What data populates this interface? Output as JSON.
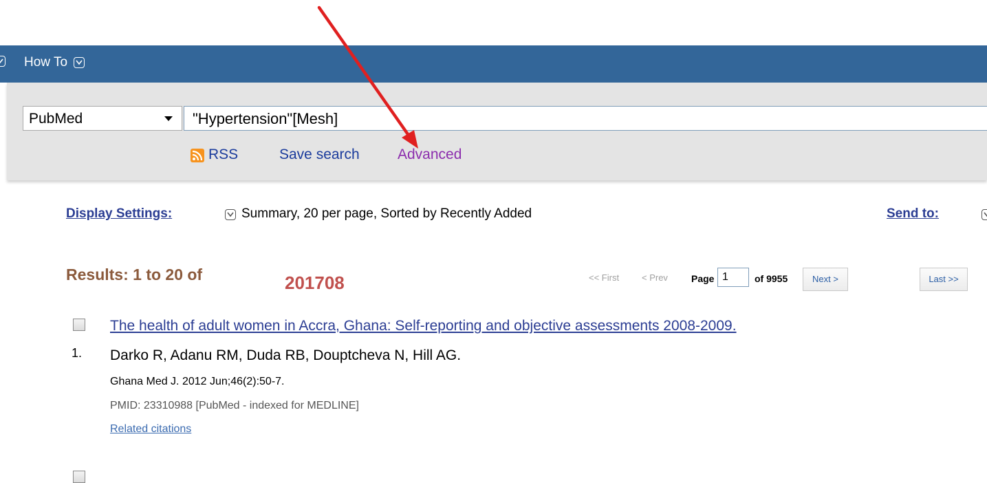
{
  "nav": {
    "howto_label": "How To"
  },
  "search": {
    "database": "PubMed",
    "query": "\"Hypertension\"[Mesh]",
    "rss_label": "RSS",
    "save_search_label": "Save search",
    "advanced_label": "Advanced"
  },
  "display": {
    "settings_label": "Display Settings:",
    "settings_value": "Summary, 20 per page, Sorted by Recently Added",
    "send_to_label": "Send to:"
  },
  "results": {
    "title": "Results: 1 to 20 of",
    "count_annotation": "201708"
  },
  "pager": {
    "first": "<< First",
    "prev": "< Prev",
    "page_label": "Page",
    "page_value": "1",
    "of_label": "of 9955",
    "next": "Next >",
    "last": "Last >>"
  },
  "items": [
    {
      "number": "1.",
      "title": "The health of adult women in Accra, Ghana: Self-reporting and objective assessments 2008-2009.",
      "authors": "Darko R, Adanu RM, Duda RB, Douptcheva N, Hill AG.",
      "journal": "Ghana Med J. 2012 Jun;46(2):50-7.",
      "pmid": "PMID: 23310988 [PubMed - indexed for MEDLINE]",
      "related": "Related citations"
    }
  ],
  "colors": {
    "nav_blue": "#336699",
    "link_blue": "#2b3d93",
    "visited_purple": "#8b2cad",
    "results_brown": "#8b5a3c",
    "annotation_red": "#e02020"
  }
}
